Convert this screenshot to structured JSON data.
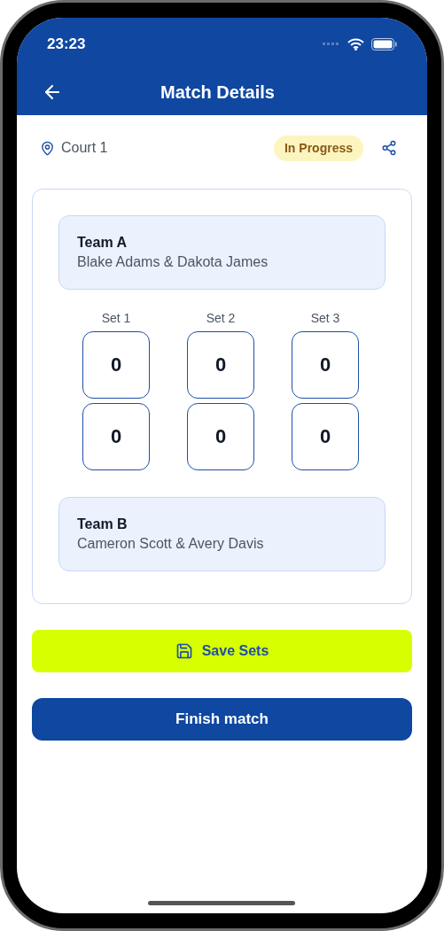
{
  "status_bar": {
    "time": "23:23"
  },
  "header": {
    "title": "Match Details"
  },
  "match": {
    "location": "Court 1",
    "status": "In Progress"
  },
  "teams": [
    {
      "name": "Team A",
      "players": "Blake Adams & Dakota James"
    },
    {
      "name": "Team B",
      "players": "Cameron Scott & Avery Davis"
    }
  ],
  "sets": [
    {
      "label": "Set 1",
      "scores": [
        "0",
        "0"
      ]
    },
    {
      "label": "Set 2",
      "scores": [
        "0",
        "0"
      ]
    },
    {
      "label": "Set 3",
      "scores": [
        "0",
        "0"
      ]
    }
  ],
  "buttons": [
    {
      "kind": "save",
      "label": "Save Sets"
    },
    {
      "kind": "primary",
      "label": "Finish match"
    }
  ]
}
